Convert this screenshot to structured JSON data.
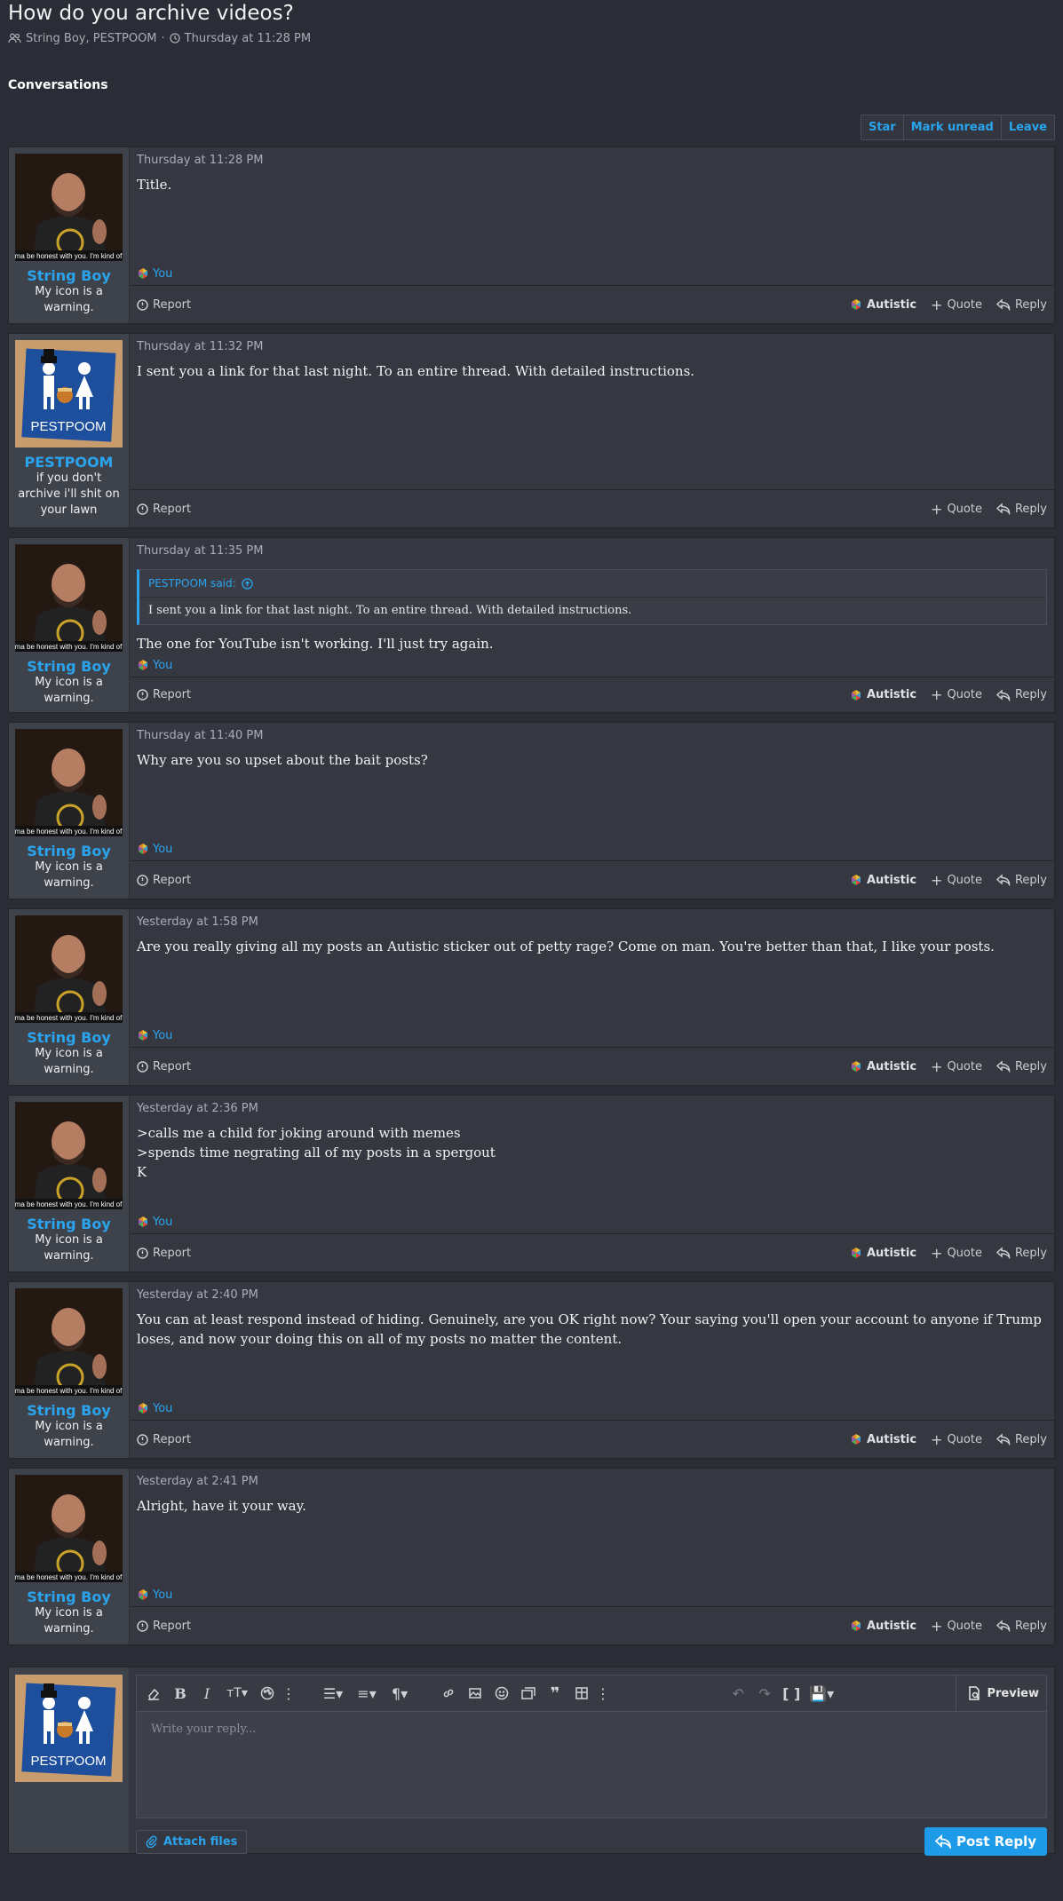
{
  "thread": {
    "title": "How do you archive videos?",
    "participants": "String Boy, PESTPOOM",
    "separator": "·",
    "date": "Thursday at 11:28 PM"
  },
  "section_title": "Conversations",
  "thread_actions": {
    "star": "Star",
    "mark_unread": "Mark unread",
    "leave": "Leave"
  },
  "footer_labels": {
    "report": "Report",
    "reaction": "Autistic",
    "quote": "Quote",
    "reply": "Reply",
    "you": "You"
  },
  "users": {
    "stringboy": {
      "name": "String Boy",
      "title": "My icon is a warning.",
      "avatar_caption": "ma be honest with you. I'm kind of"
    },
    "pestpoom": {
      "name": "PESTPOOM",
      "title": "if you don't archive i'll shit on your lawn",
      "avatar_text": "PESTPOOM"
    }
  },
  "messages": [
    {
      "user": "stringboy",
      "date": "Thursday at 11:28 PM",
      "body": "Title.",
      "reacted": true,
      "show_reaction_button": true
    },
    {
      "user": "pestpoom",
      "date": "Thursday at 11:32 PM",
      "body": "I sent you a link for that last night. To an entire thread. With detailed instructions.",
      "reacted": false,
      "show_reaction_button": false
    },
    {
      "user": "stringboy",
      "date": "Thursday at 11:35 PM",
      "quote": {
        "author": "PESTPOOM said:",
        "text": "I sent you a link for that last night. To an entire thread. With detailed instructions."
      },
      "body": "The one for YouTube isn't working. I'll just try again.",
      "reacted": true,
      "show_reaction_button": true
    },
    {
      "user": "stringboy",
      "date": "Thursday at 11:40 PM",
      "body": "Why are you so upset about the bait posts?",
      "reacted": true,
      "show_reaction_button": true
    },
    {
      "user": "stringboy",
      "date": "Yesterday at 1:58 PM",
      "body": "Are you really giving all my posts an Autistic sticker out of petty rage? Come on man. You're better than that, I like your posts.",
      "reacted": true,
      "show_reaction_button": true
    },
    {
      "user": "stringboy",
      "date": "Yesterday at 2:36 PM",
      "body_lines": [
        ">calls me a child for joking around with memes",
        ">spends time negrating all of my posts in a spergout",
        "K"
      ],
      "reacted": true,
      "show_reaction_button": true
    },
    {
      "user": "stringboy",
      "date": "Yesterday at 2:40 PM",
      "body": "You can at least respond instead of hiding. Genuinely, are you OK right now? Your saying you'll open your account to anyone if Trump loses, and now your doing this on all of my posts no matter the content.",
      "reacted": true,
      "show_reaction_button": true
    },
    {
      "user": "stringboy",
      "date": "Yesterday at 2:41 PM",
      "body": "Alright, have it your way.",
      "reacted": true,
      "show_reaction_button": true
    }
  ],
  "reply": {
    "placeholder": "Write your reply...",
    "preview": "Preview",
    "attach": "Attach files",
    "post": "Post Reply"
  },
  "colors": {
    "accent": "#2aa4ee",
    "background": "#2a2d35",
    "panel": "#353841",
    "sidebar": "#3e424b"
  }
}
